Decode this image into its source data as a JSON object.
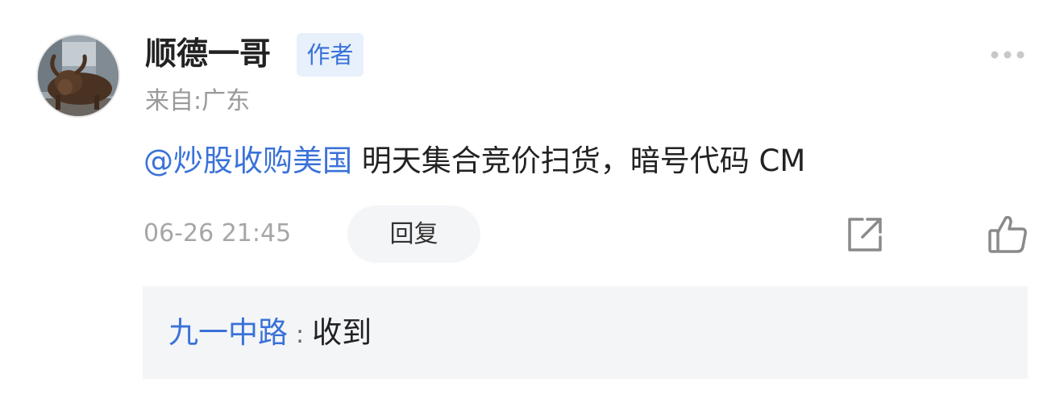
{
  "comment": {
    "user": {
      "name": "顺德一哥",
      "badge": "作者",
      "location": "来自:广东",
      "avatar": "bull-statue-avatar"
    },
    "mention": "@炒股收购美国",
    "text": " 明天集合竞价扫货，暗号代码 CM",
    "timestamp": "06-26 21:45",
    "reply_label": "回复",
    "icons": {
      "more": "more-dots-icon",
      "share": "share-icon",
      "like": "thumbs-up-icon"
    }
  },
  "replies": [
    {
      "name": "九一中路",
      "separator": ":",
      "text": "收到"
    }
  ],
  "colors": {
    "link_blue": "#3a72d8",
    "badge_bg": "#e7f0fb",
    "muted_gray": "#999999",
    "panel_bg": "#f4f5f7"
  }
}
